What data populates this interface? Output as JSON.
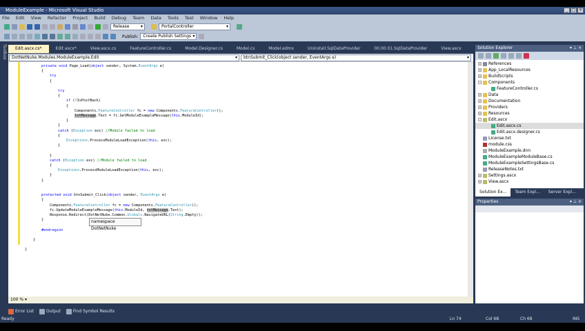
{
  "window": {
    "title": "ModuleExample - Microsoft Visual Studio"
  },
  "menu": [
    "File",
    "Edit",
    "View",
    "Refactor",
    "Project",
    "Build",
    "Debug",
    "Team",
    "Data",
    "Tools",
    "Test",
    "Window",
    "Help"
  ],
  "toolbar": {
    "config": "Release",
    "project": "PortalController",
    "publish_label": "Publish:",
    "publish_value": "Create Publish Settings"
  },
  "tabs": [
    "Edit.ascx.cs*",
    "Edit.ascx*",
    "View.ascx.cs",
    "FeatureController.cs",
    "Model.Designer.cs",
    "Model.cs",
    "Model.edmx",
    "Uninstall.SqlDataProvider",
    "00.00.01.SqlDataProvider",
    "View.ascx"
  ],
  "nav": {
    "type": "DotNetNuke.Modules.ModuleExample.Edit",
    "member": "btnSubmit_Click(object sender, EventArgs e)"
  },
  "code": [
    [
      4,
      [
        [
          "kw",
          "private void "
        ],
        [
          "",
          "Page_Load("
        ],
        [
          "kw",
          "object"
        ],
        [
          "",
          " sender, System."
        ],
        [
          "ty",
          "EventArgs"
        ],
        [
          "",
          " e)"
        ]
      ]
    ],
    [
      4,
      [
        [
          "",
          "{"
        ]
      ]
    ],
    [
      5,
      [
        [
          "kw",
          "try"
        ]
      ]
    ],
    [
      5,
      [
        [
          "",
          "{"
        ]
      ]
    ],
    [
      0,
      []
    ],
    [
      6,
      [
        [
          "kw",
          "try"
        ]
      ]
    ],
    [
      6,
      [
        [
          "",
          "{"
        ]
      ]
    ],
    [
      7,
      [
        [
          "kw",
          "if"
        ],
        [
          "",
          " (!IsPostBack)"
        ]
      ]
    ],
    [
      7,
      [
        [
          "",
          "{"
        ]
      ]
    ],
    [
      8,
      [
        [
          "",
          "Components."
        ],
        [
          "ty",
          "FeatureController"
        ],
        [
          "",
          " fc = "
        ],
        [
          "kw",
          "new"
        ],
        [
          "",
          " Components."
        ],
        [
          "ty",
          "FeatureController"
        ],
        [
          "",
          "();"
        ]
      ]
    ],
    [
      8,
      [
        [
          "hl",
          "txtMessage"
        ],
        [
          "",
          ".Text = fc.GetModuleExampleMessage("
        ],
        [
          "kw",
          "this"
        ],
        [
          "",
          ".ModuleId);"
        ]
      ]
    ],
    [
      7,
      [
        [
          "",
          "}"
        ]
      ]
    ],
    [
      6,
      [
        [
          "",
          "}"
        ]
      ]
    ],
    [
      6,
      [
        [
          "kw",
          "catch"
        ],
        [
          "",
          " ("
        ],
        [
          "ty",
          "Exception"
        ],
        [
          "",
          " exc) "
        ],
        [
          "cm",
          "//Module failed to load"
        ]
      ]
    ],
    [
      6,
      [
        [
          "",
          "{"
        ]
      ]
    ],
    [
      7,
      [
        [
          "ty",
          "Exceptions"
        ],
        [
          "",
          ".ProcessModuleLoadException("
        ],
        [
          "kw",
          "this"
        ],
        [
          "",
          ", exc);"
        ]
      ]
    ],
    [
      6,
      [
        [
          "",
          "}"
        ]
      ]
    ],
    [
      0,
      []
    ],
    [
      5,
      [
        [
          "",
          "}"
        ]
      ]
    ],
    [
      5,
      [
        [
          "kw",
          "catch"
        ],
        [
          "",
          " ("
        ],
        [
          "ty",
          "Exception"
        ],
        [
          "",
          " exc) "
        ],
        [
          "cm",
          "//Module failed to load"
        ]
      ]
    ],
    [
      5,
      [
        [
          "",
          "{"
        ]
      ]
    ],
    [
      6,
      [
        [
          "ty",
          "Exceptions"
        ],
        [
          "",
          ".ProcessModuleLoadException("
        ],
        [
          "kw",
          "this"
        ],
        [
          "",
          ", exc);"
        ]
      ]
    ],
    [
      5,
      [
        [
          "",
          "}"
        ]
      ]
    ],
    [
      4,
      [
        [
          "",
          "}"
        ]
      ]
    ],
    [
      0,
      []
    ],
    [
      0,
      []
    ],
    [
      4,
      [
        [
          "kw",
          "protected void "
        ],
        [
          "",
          "btnSubmit_Click("
        ],
        [
          "kw",
          "object"
        ],
        [
          "",
          " sender, "
        ],
        [
          "ty",
          "EventArgs"
        ],
        [
          "",
          " e)"
        ]
      ]
    ],
    [
      4,
      [
        [
          "",
          "{"
        ]
      ]
    ],
    [
      5,
      [
        [
          "",
          "Components."
        ],
        [
          "ty",
          "FeatureController"
        ],
        [
          "",
          " fc = "
        ],
        [
          "kw",
          "new"
        ],
        [
          "",
          " Components."
        ],
        [
          "ty",
          "FeatureController"
        ],
        [
          "",
          "();"
        ]
      ]
    ],
    [
      5,
      [
        [
          "",
          "fc.UpdateModuleExampleMessage("
        ],
        [
          "kw",
          "this"
        ],
        [
          "",
          ".ModuleId, "
        ],
        [
          "hl",
          "txtMessage"
        ],
        [
          "",
          ".Text);"
        ]
      ]
    ],
    [
      5,
      [
        [
          "",
          "Response.Redirect(DotNetNuke.Common."
        ],
        [
          "ty",
          "Globals"
        ],
        [
          "",
          ".NavigateURL("
        ],
        [
          "ty",
          "String"
        ],
        [
          "",
          ".Empty));"
        ]
      ]
    ],
    [
      4,
      [
        [
          "",
          "}"
        ]
      ]
    ],
    [
      0,
      []
    ],
    [
      4,
      [
        [
          "kw",
          "#endregion"
        ]
      ]
    ],
    [
      0,
      []
    ],
    [
      3,
      [
        [
          "",
          "}"
        ]
      ]
    ],
    [
      0,
      []
    ],
    [
      2,
      [
        [
          "",
          "}"
        ]
      ]
    ]
  ],
  "tooltip": "namespace DotNetNuke",
  "zoom": "100 %",
  "solution_explorer": {
    "title": "Solution Explorer",
    "items": [
      {
        "label": "References",
        "exp": "+",
        "lvl": 0,
        "icon": "references"
      },
      {
        "label": "App_LocalResources",
        "exp": "+",
        "lvl": 0,
        "icon": "folder"
      },
      {
        "label": "BuildScripts",
        "exp": "+",
        "lvl": 0,
        "icon": "folder"
      },
      {
        "label": "Components",
        "exp": "-",
        "lvl": 0,
        "icon": "folder"
      },
      {
        "label": "FeatureController.cs",
        "exp": "",
        "lvl": 1,
        "icon": "cs-file"
      },
      {
        "label": "Data",
        "exp": "+",
        "lvl": 0,
        "icon": "folder"
      },
      {
        "label": "Documentation",
        "exp": "+",
        "lvl": 0,
        "icon": "folder"
      },
      {
        "label": "Providers",
        "exp": "+",
        "lvl": 0,
        "icon": "folder"
      },
      {
        "label": "Resources",
        "exp": "+",
        "lvl": 0,
        "icon": "folder"
      },
      {
        "label": "Edit.ascx",
        "exp": "-",
        "lvl": 0,
        "icon": "ascx-file"
      },
      {
        "label": "Edit.ascx.cs",
        "exp": "",
        "lvl": 1,
        "icon": "cs-file",
        "selected": true
      },
      {
        "label": "Edit.ascx.designer.cs",
        "exp": "",
        "lvl": 1,
        "icon": "cs-file"
      },
      {
        "label": "License.txt",
        "exp": "",
        "lvl": 0,
        "icon": "text-file"
      },
      {
        "label": "module.css",
        "exp": "",
        "lvl": 0,
        "icon": "css-file"
      },
      {
        "label": "ModuleExample.dnn",
        "exp": "",
        "lvl": 0,
        "icon": "file"
      },
      {
        "label": "ModuleExampleModuleBase.cs",
        "exp": "",
        "lvl": 0,
        "icon": "cs-file"
      },
      {
        "label": "ModuleExampleSettingsBase.cs",
        "exp": "",
        "lvl": 0,
        "icon": "cs-file"
      },
      {
        "label": "ReleaseNotes.txt",
        "exp": "",
        "lvl": 0,
        "icon": "text-file"
      },
      {
        "label": "Settings.ascx",
        "exp": "+",
        "lvl": 0,
        "icon": "ascx-file"
      },
      {
        "label": "View.ascx",
        "exp": "+",
        "lvl": 0,
        "icon": "ascx-file"
      }
    ],
    "tabs": [
      "Solution Ex...",
      "Team Expl...",
      "Server Expl..."
    ]
  },
  "properties": {
    "title": "Properties"
  },
  "tool_strip": "Toolbox",
  "bottom_tabs": [
    "Error List",
    "Output",
    "Find Symbol Results"
  ],
  "status": {
    "text": "Ready",
    "ln": "Ln 74",
    "col": "Col 68",
    "ch": "Ch 68",
    "mode": "INS"
  }
}
